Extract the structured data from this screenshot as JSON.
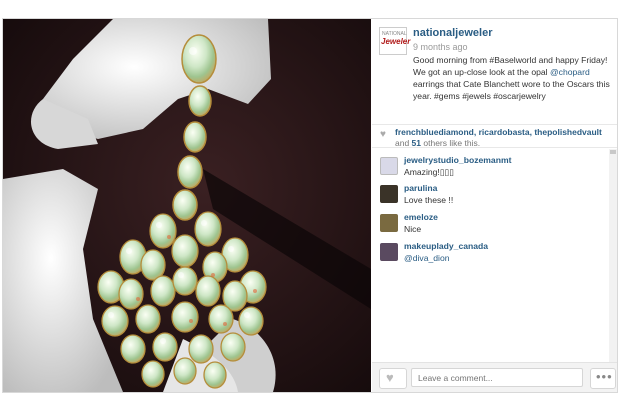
{
  "post": {
    "username": "nationaljeweler",
    "time_ago": "9 months ago",
    "logo": {
      "top_text": "NATIONAL",
      "main_text": "Jeweler"
    },
    "caption_pre": "Good morning from #Baselworld and happy Friday! We got an up-close look at the opal ",
    "caption_mention": "@chopard",
    "caption_post": " earrings that Cate Blanchett wore to the Oscars this year. #gems #jewels #oscarjewelry"
  },
  "likes": {
    "users": "frenchbluediamond, ricardobasta, thepolishedvault",
    "and": " and ",
    "count": "51",
    "suffix": " others like this."
  },
  "comments": [
    {
      "user": "jewelrystudio_bozemanmt",
      "text": "Amazing!▯▯▯",
      "avatar_color": "#d9d9e8"
    },
    {
      "user": "parulina",
      "text": "Love these !!",
      "avatar_color": "#3a3328"
    },
    {
      "user": "emeloze",
      "text": "Nice",
      "avatar_color": "#7a6a40"
    },
    {
      "user": "makeuplady_canada",
      "text": "@diva_dion",
      "avatar_color": "#5a4a60"
    }
  ],
  "footer": {
    "comment_placeholder": "Leave a comment...",
    "more_label": "•••",
    "heart": "♥"
  },
  "colors": {
    "link": "#2a5d84",
    "photo_bg": "#1b0f10"
  },
  "icons": {
    "like": "heart-icon",
    "more": "ellipsis-icon"
  }
}
